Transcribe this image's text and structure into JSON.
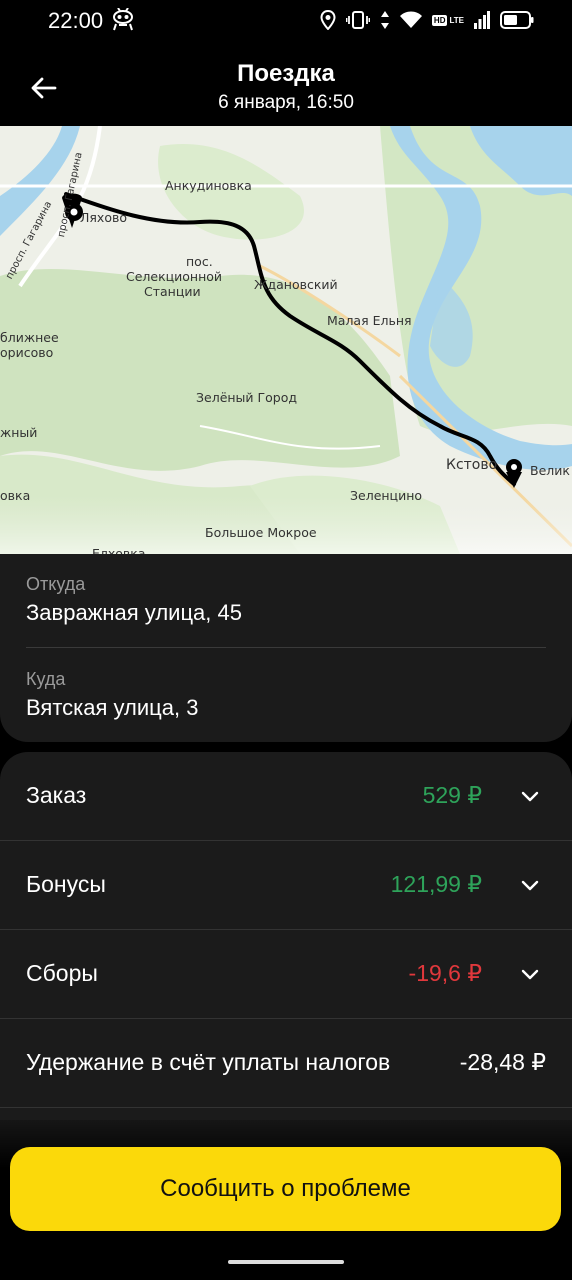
{
  "status_bar": {
    "time": "22:00",
    "network": "LTE",
    "hd": "HD"
  },
  "header": {
    "title": "Поездка",
    "subtitle": "6 января, 16:50"
  },
  "map": {
    "labels": {
      "ankudinovka": "Анкудиновка",
      "lyakhovo": "Ляхово",
      "pos": "пос.",
      "selektsionnoy": "Селекционной",
      "stantsii": "Станции",
      "zhdanovsky": "Ждановский",
      "malaya_elnya": "Малая Ельня",
      "blizhnee": "ближнее",
      "borisovo": "орисово",
      "zeleny_gorod": "Зелёный Город",
      "nyy": "жный",
      "kstovo": "Кстово",
      "veliky": "Велик",
      "ovka": "овка",
      "zelenitsyno": "Зеленцино",
      "bolshoe_mokroe": "Большое Мокрое",
      "blinovka": "Елховка",
      "prosp_gagarina_1": "просп. Гагарина",
      "prosp_gagarina_2": "просп. Гагарина"
    }
  },
  "route": {
    "from_label": "Откуда",
    "from_value": "Завражная улица, 45",
    "to_label": "Куда",
    "to_value": "Вятская улица, 3"
  },
  "details": {
    "order_label": "Заказ",
    "order_value": "529 ₽",
    "bonus_label": "Бонусы",
    "bonus_value": "121,99 ₽",
    "fees_label": "Сборы",
    "fees_value": "-19,6 ₽",
    "tax_label": "Удержание в счёт уплаты налогов",
    "tax_value": "-28,48 ₽"
  },
  "actions": {
    "report_label": "Сообщить о проблеме"
  },
  "colors": {
    "accent": "#fbd90a",
    "positive": "#2ea35a",
    "negative": "#e0383c",
    "card": "#1b1b1b"
  }
}
